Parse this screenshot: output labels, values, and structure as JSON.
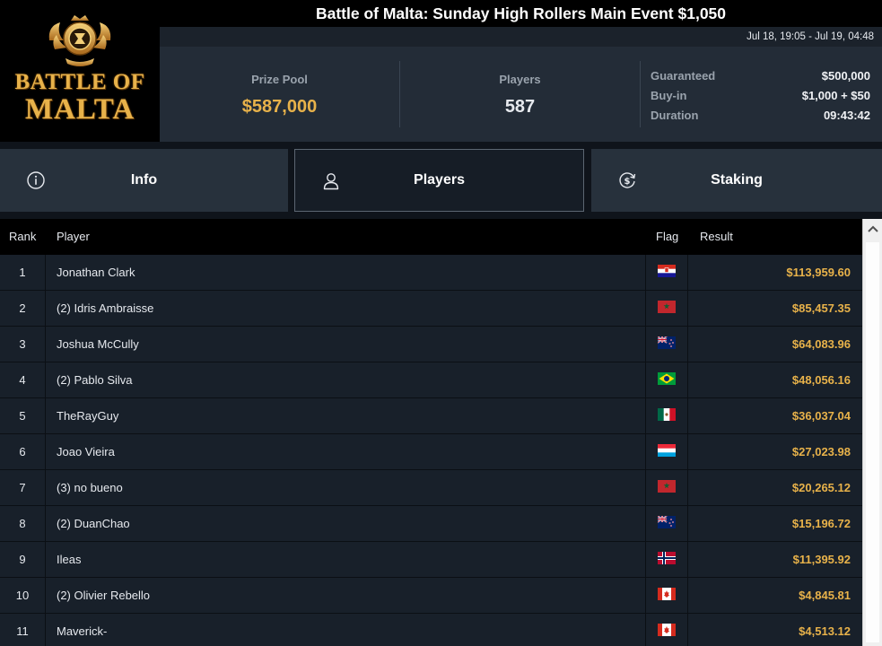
{
  "header": {
    "logo_line1": "BATTLE OF",
    "logo_line2": "MALTA",
    "title": "Battle of Malta: Sunday High Rollers Main Event $1,050",
    "date_range": "Jul 18, 19:05 - Jul 19, 04:48"
  },
  "stats": {
    "prize_pool_label": "Prize Pool",
    "prize_pool_value": "$587,000",
    "players_label": "Players",
    "players_value": "587",
    "guaranteed_label": "Guaranteed",
    "guaranteed_value": "$500,000",
    "buyin_label": "Buy-in",
    "buyin_value": "$1,000 + $50",
    "duration_label": "Duration",
    "duration_value": "09:43:42"
  },
  "tabs": {
    "info": "Info",
    "players": "Players",
    "staking": "Staking",
    "active": "players"
  },
  "table": {
    "headers": {
      "rank": "Rank",
      "player": "Player",
      "flag": "Flag",
      "result": "Result"
    },
    "rows": [
      {
        "rank": "1",
        "player": "Jonathan Clark",
        "flag": "croatia",
        "result": "$113,959.60"
      },
      {
        "rank": "2",
        "player": "(2) Idris Ambraisse",
        "flag": "morocco",
        "result": "$85,457.35"
      },
      {
        "rank": "3",
        "player": "Joshua McCully",
        "flag": "new-zealand",
        "result": "$64,083.96"
      },
      {
        "rank": "4",
        "player": "(2) Pablo Silva",
        "flag": "brazil",
        "result": "$48,056.16"
      },
      {
        "rank": "5",
        "player": "TheRayGuy",
        "flag": "mexico",
        "result": "$36,037.04"
      },
      {
        "rank": "6",
        "player": "Joao Vieira",
        "flag": "luxembourg",
        "result": "$27,023.98"
      },
      {
        "rank": "7",
        "player": "(3) no bueno",
        "flag": "morocco",
        "result": "$20,265.12"
      },
      {
        "rank": "8",
        "player": "(2) DuanChao",
        "flag": "new-zealand",
        "result": "$15,196.72"
      },
      {
        "rank": "9",
        "player": "Ileas",
        "flag": "norway",
        "result": "$11,395.92"
      },
      {
        "rank": "10",
        "player": "(2) Olivier Rebello",
        "flag": "canada",
        "result": "$4,845.81"
      },
      {
        "rank": "11",
        "player": "Maverick-",
        "flag": "canada",
        "result": "$4,513.12"
      }
    ]
  },
  "colors": {
    "accent_gold": "#e8b24a",
    "panel": "#232c37",
    "row_bg": "#18202a"
  }
}
